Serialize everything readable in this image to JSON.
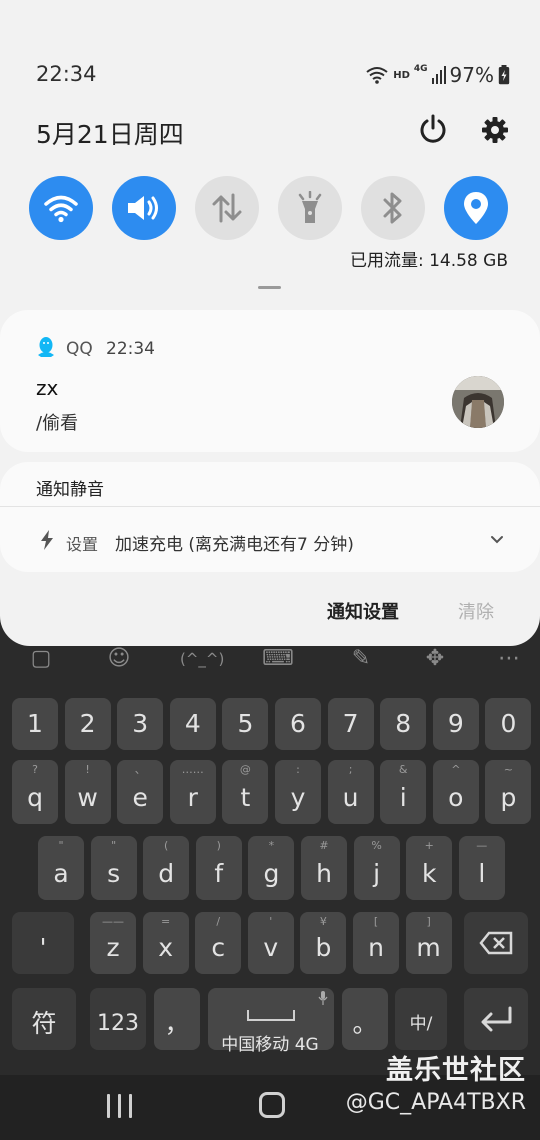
{
  "status_bar": {
    "time": "22:34",
    "network_badge": "HD",
    "network_gen": "4G",
    "battery_percent": "97%"
  },
  "shade": {
    "date": "5月21日周四",
    "quick_settings": [
      {
        "name": "wifi",
        "icon": "wifi-icon",
        "state": "on"
      },
      {
        "name": "sound",
        "icon": "speaker-icon",
        "state": "on"
      },
      {
        "name": "mobile-data",
        "icon": "data-arrows-icon",
        "state": "off"
      },
      {
        "name": "flashlight",
        "icon": "flashlight-icon",
        "state": "off"
      },
      {
        "name": "bluetooth",
        "icon": "bluetooth-icon",
        "state": "off"
      },
      {
        "name": "location",
        "icon": "location-pin-icon",
        "state": "on"
      }
    ],
    "data_usage": "已用流量: 14.58 GB"
  },
  "notifications": {
    "qq": {
      "app": "QQ",
      "time": "22:34",
      "title": "zx",
      "text": "/偷看"
    },
    "silent_section": {
      "title": "通知静音",
      "item_app": "设置",
      "item_text": "加速充电 (离充满电还有7 分钟)"
    },
    "actions": {
      "settings": "通知设置",
      "clear": "清除"
    }
  },
  "keyboard": {
    "number_row": [
      "1",
      "2",
      "3",
      "4",
      "5",
      "6",
      "7",
      "8",
      "9",
      "0"
    ],
    "row1": [
      {
        "k": "q",
        "s": "?"
      },
      {
        "k": "w",
        "s": "!"
      },
      {
        "k": "e",
        "s": "、"
      },
      {
        "k": "r",
        "s": "……"
      },
      {
        "k": "t",
        "s": "@"
      },
      {
        "k": "y",
        "s": ":"
      },
      {
        "k": "u",
        "s": ";"
      },
      {
        "k": "i",
        "s": "&"
      },
      {
        "k": "o",
        "s": "^"
      },
      {
        "k": "p",
        "s": "~"
      }
    ],
    "row2": [
      {
        "k": "a",
        "s": "\""
      },
      {
        "k": "s",
        "s": "\""
      },
      {
        "k": "d",
        "s": "("
      },
      {
        "k": "f",
        "s": ")"
      },
      {
        "k": "g",
        "s": "*"
      },
      {
        "k": "h",
        "s": "#"
      },
      {
        "k": "j",
        "s": "%"
      },
      {
        "k": "k",
        "s": "+"
      },
      {
        "k": "l",
        "s": "—"
      }
    ],
    "row3": [
      {
        "k": "z",
        "s": "——"
      },
      {
        "k": "x",
        "s": "="
      },
      {
        "k": "c",
        "s": "/"
      },
      {
        "k": "v",
        "s": "'"
      },
      {
        "k": "b",
        "s": "¥"
      },
      {
        "k": "n",
        "s": "["
      },
      {
        "k": "m",
        "s": "]"
      }
    ],
    "apostrophe": "'",
    "symbols_key": "符",
    "numbers_key": "123",
    "comma": "，",
    "period": "。",
    "lang_key": "中/"
  },
  "carrier": "中国移动 4G",
  "watermark": {
    "title": "盖乐世社区",
    "handle": "@GC_APA4TBXR"
  }
}
